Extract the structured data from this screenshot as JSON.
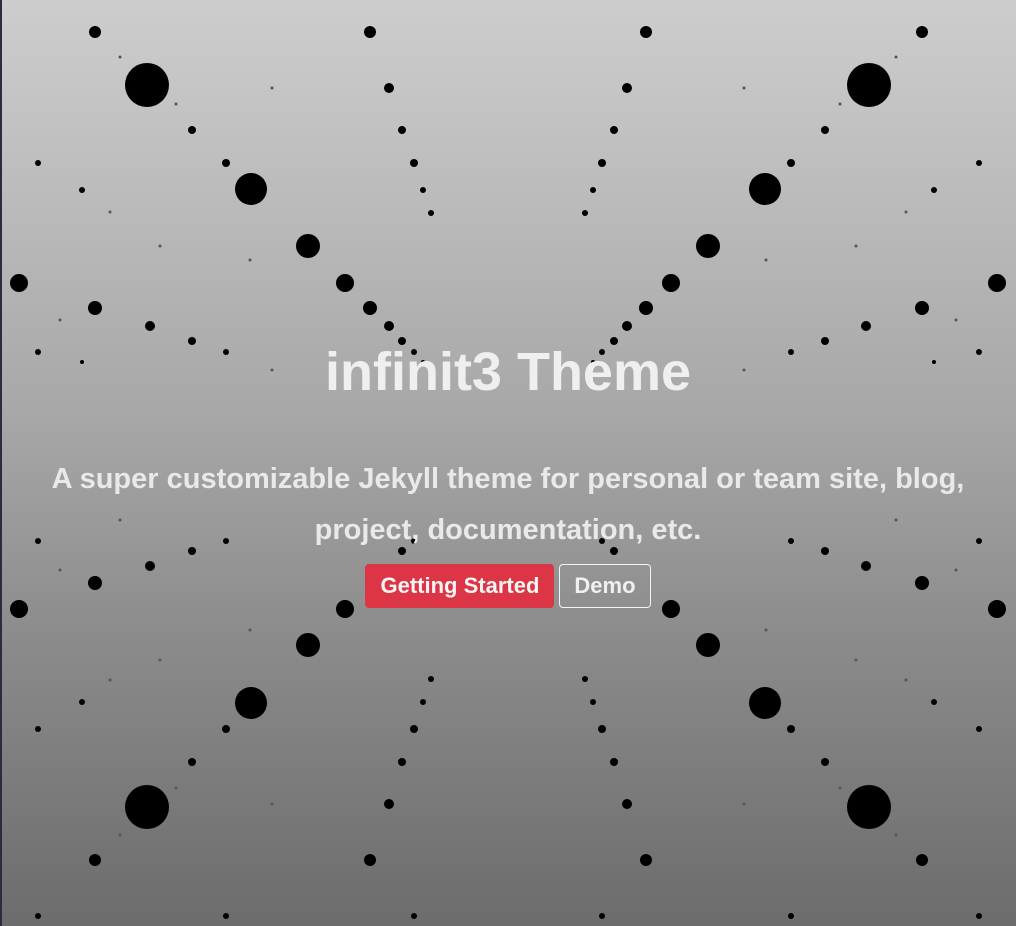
{
  "hero": {
    "title": "infinit3 Theme",
    "subtitle": "A super customizable Jekyll theme for personal or team site, blog, project, documentation, etc.",
    "buttons": {
      "primary_label": "Getting Started",
      "secondary_label": "Demo"
    }
  },
  "colors": {
    "primary_button": "#dc3545",
    "text": "#efefef",
    "dots": "#000000"
  }
}
